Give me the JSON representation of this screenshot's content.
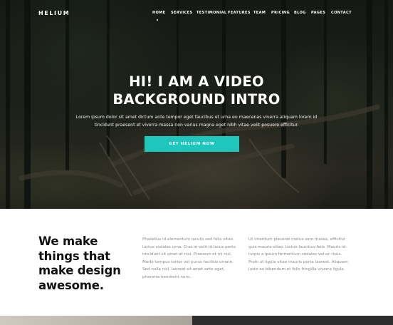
{
  "brand": {
    "logo": "HELIUM"
  },
  "nav": {
    "items": [
      {
        "label": "HOME",
        "active": true
      },
      {
        "label": "SERVICES"
      },
      {
        "label": "TESTIMONIAL"
      },
      {
        "label": "FEATURES"
      },
      {
        "label": "TEAM"
      },
      {
        "label": "PRICING"
      },
      {
        "label": "BLOG"
      },
      {
        "label": "PAGES"
      },
      {
        "label": "CONTACT"
      }
    ]
  },
  "hero": {
    "title_line1": "HI! I AM A VIDEO",
    "title_line2": "BACKGROUND INTRO",
    "subtitle": "Lorem ipsum dolor sit amet dictum ante tempor eget faucibus et urna eu maecenas viverra aliquam lorem id tincidunt praesent et viverra massa non varius magna eget nibh vitae velit posuere efficitur.",
    "cta_label": "GET HELIUM NOW"
  },
  "about": {
    "heading_line1": "We make",
    "heading_line2": "things that",
    "heading_line3": "make design",
    "heading_line4": "awesome.",
    "col1": "Phasellus id elementum iaculis sed felis vitae, luctus sodales urna. Cras in velit id lacus porta tincidunt sit amet at nisl. Praesent et mi nisl. Morbi tempus tortor vel purus facilisis ornare. Sed nulla nisl, laoreet sit amet ante eget, pharetra hendrerit nunc.",
    "col2": "Ut interdum placerat metus sem massa, efficitur quis mauris vitae, luctus faucibus felis. Mauris id turpis a ipsum fermentum sodales vel ac risus. Proin ut ligula vitae mauris porta laoreet. Aliquam justo ex bibendum et felis fringilla viverra ligula."
  },
  "colors": {
    "accent": "#1ec6be",
    "dark": "#2d2d2d",
    "text_muted": "#8a8a8a"
  }
}
